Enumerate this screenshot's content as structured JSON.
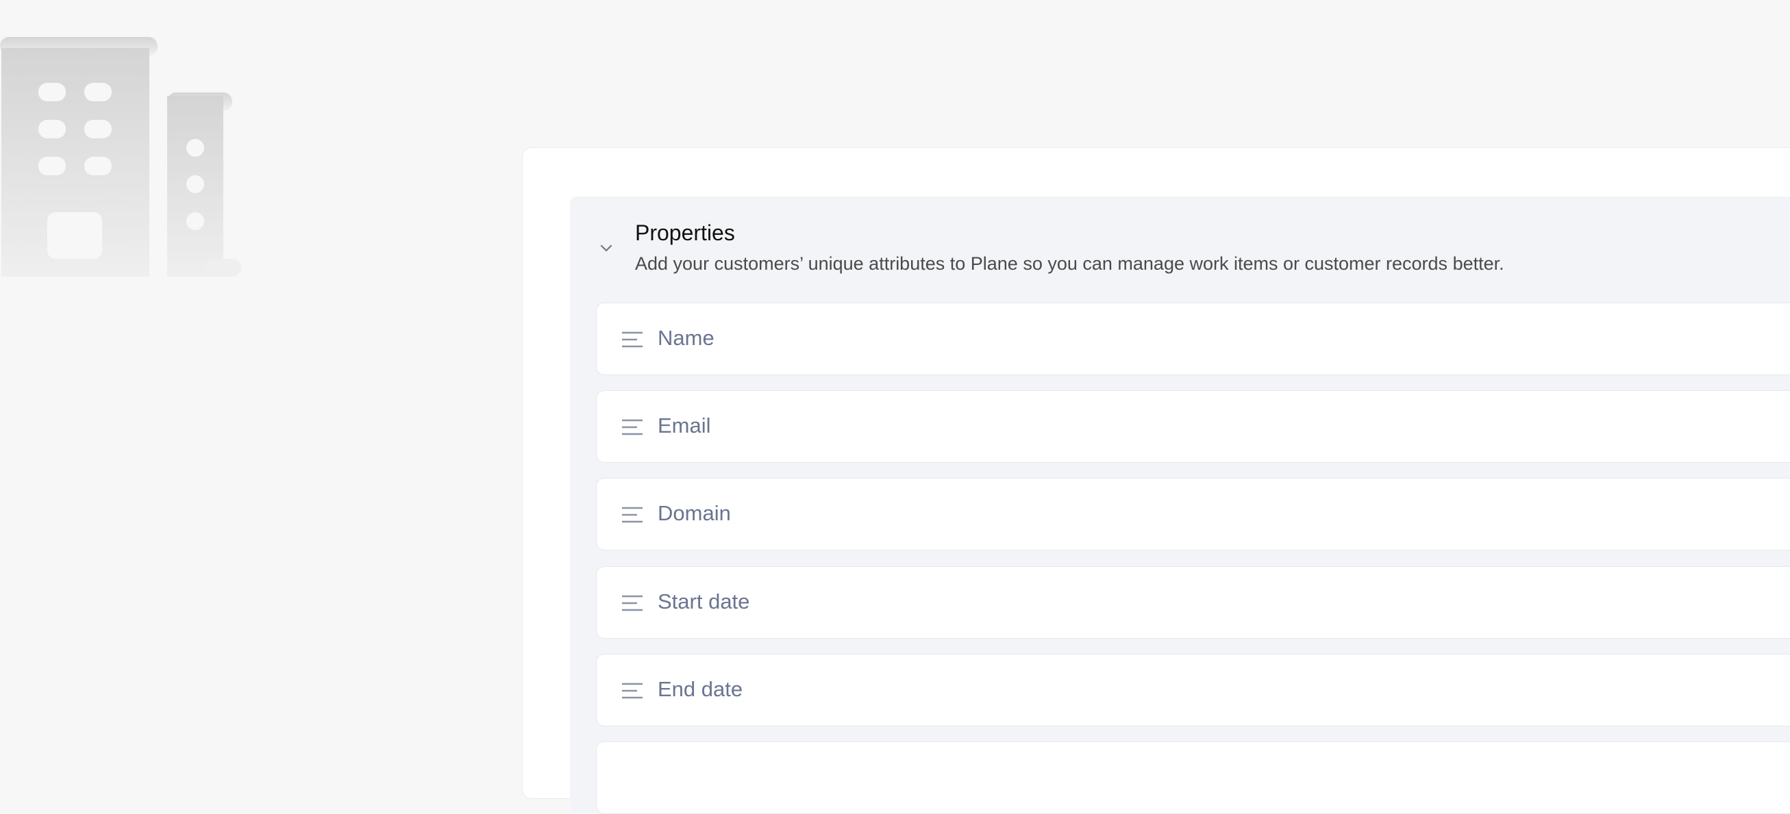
{
  "section": {
    "title": "Properties",
    "description": "Add your customers’ unique attributes to Plane so you can manage work items or customer records better."
  },
  "properties": [
    {
      "label": "Name",
      "icon": "text-align-left-icon"
    },
    {
      "label": "Email",
      "icon": "text-align-left-icon"
    },
    {
      "label": "Domain",
      "icon": "text-align-left-icon"
    },
    {
      "label": "Start date",
      "icon": "text-align-left-icon"
    },
    {
      "label": "End date",
      "icon": "text-align-left-icon"
    },
    {
      "label": "",
      "icon": ""
    }
  ]
}
